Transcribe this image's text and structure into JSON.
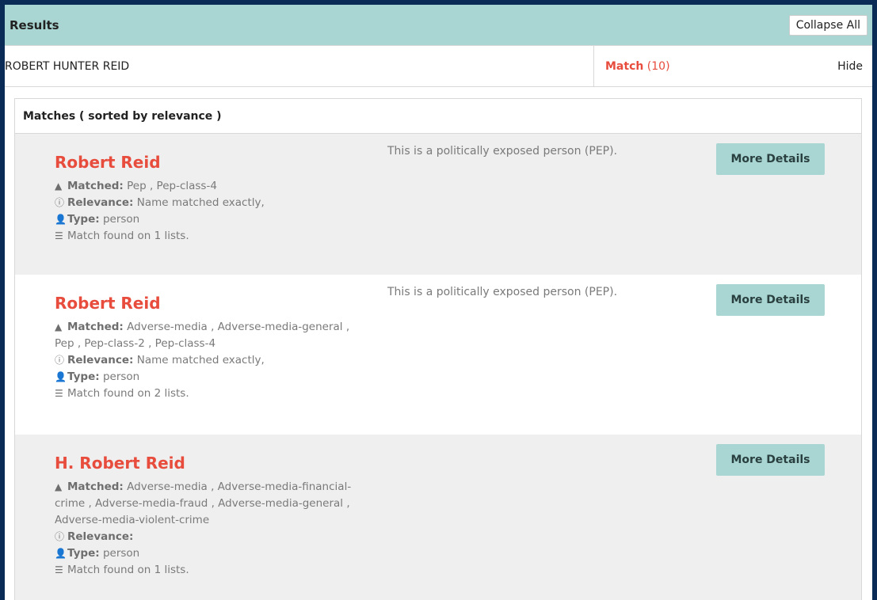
{
  "results": {
    "title": "Results",
    "collapse_label": "Collapse All"
  },
  "subject": {
    "name": "ROBERT HUNTER REID",
    "match_label": "Match",
    "match_count": "(10)",
    "hide_label": "Hide"
  },
  "matches": {
    "header": "Matches ( sorted by relevance )",
    "items": [
      {
        "name": "Robert Reid",
        "pep_note": "This is a politically exposed person (PEP).",
        "matched_label": "Matched:",
        "matched": "Pep , Pep-class-4",
        "relevance_label": "Relevance:",
        "relevance": "Name matched exactly,",
        "type_label": "Type:",
        "type": "person",
        "lists": "Match found on 1 lists.",
        "button": "More Details"
      },
      {
        "name": "Robert Reid",
        "pep_note": "This is a politically exposed person (PEP).",
        "matched_label": "Matched:",
        "matched": "Adverse-media , Adverse-media-general , Pep , Pep-class-2 , Pep-class-4",
        "relevance_label": "Relevance:",
        "relevance": "Name matched exactly,",
        "type_label": "Type:",
        "type": "person",
        "lists": "Match found on 2 lists.",
        "button": "More Details"
      },
      {
        "name": "H. Robert Reid",
        "pep_note": "",
        "matched_label": "Matched:",
        "matched": "Adverse-media , Adverse-media-financial-crime , Adverse-media-fraud , Adverse-media-general , Adverse-media-violent-crime",
        "relevance_label": "Relevance:",
        "relevance": "",
        "type_label": "Type:",
        "type": "person",
        "lists": "Match found on 1 lists.",
        "button": "More Details"
      }
    ]
  },
  "icons": {
    "matched": "warning-icon",
    "relevance": "info-circle-icon",
    "type": "user-icon",
    "lists": "list-icon"
  },
  "colors": {
    "header_bg": "#a9d6d2",
    "accent_red": "#e74c3c",
    "frame_bg": "#0b2b57",
    "row_grey": "#efefef"
  }
}
